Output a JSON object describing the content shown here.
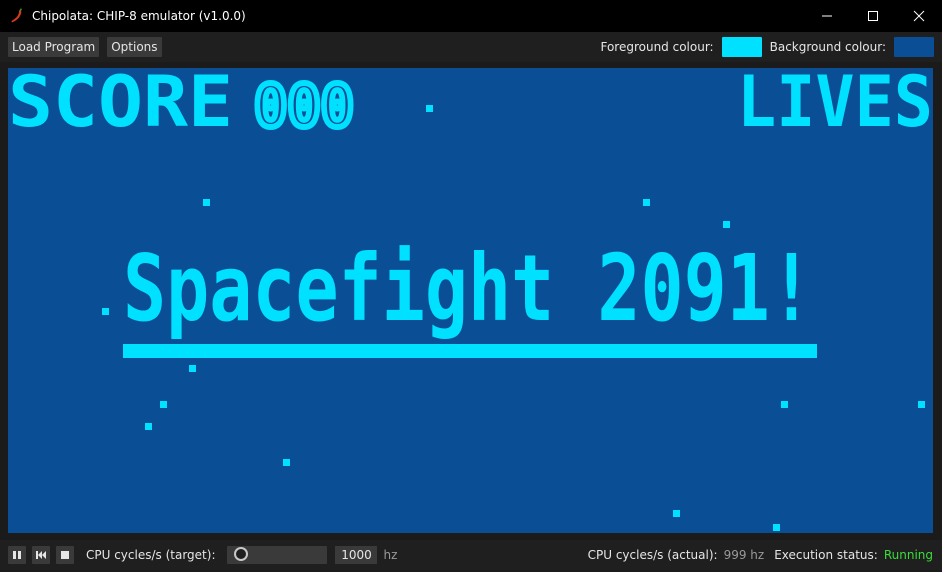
{
  "window": {
    "title": "Chipolata: CHIP-8 emulator (v1.0.0)",
    "app_icon": "chili-icon",
    "controls": {
      "minimize": "─",
      "maximize": "☐",
      "close": "✕"
    }
  },
  "menubar": {
    "load_program": "Load Program",
    "options": "Options",
    "foreground_label": "Foreground colour:",
    "background_label": "Background colour:",
    "foreground_colour": "#00e1ff",
    "background_colour": "#0a4f96"
  },
  "screen": {
    "score_label": "SCORE",
    "score_value": "000",
    "lives_label": "LIVES",
    "game_title": "Spacefight 2091!"
  },
  "statusbar": {
    "controls": [
      "pause-icon",
      "restart-icon",
      "stop-icon"
    ],
    "cpu_target_label": "CPU cycles/s (target):",
    "cpu_target_value": "1000",
    "cpu_target_unit": "hz",
    "cpu_actual_label": "CPU cycles/s (actual):",
    "cpu_actual_value": "999 hz",
    "exec_status_label": "Execution status:",
    "exec_status_value": "Running"
  }
}
